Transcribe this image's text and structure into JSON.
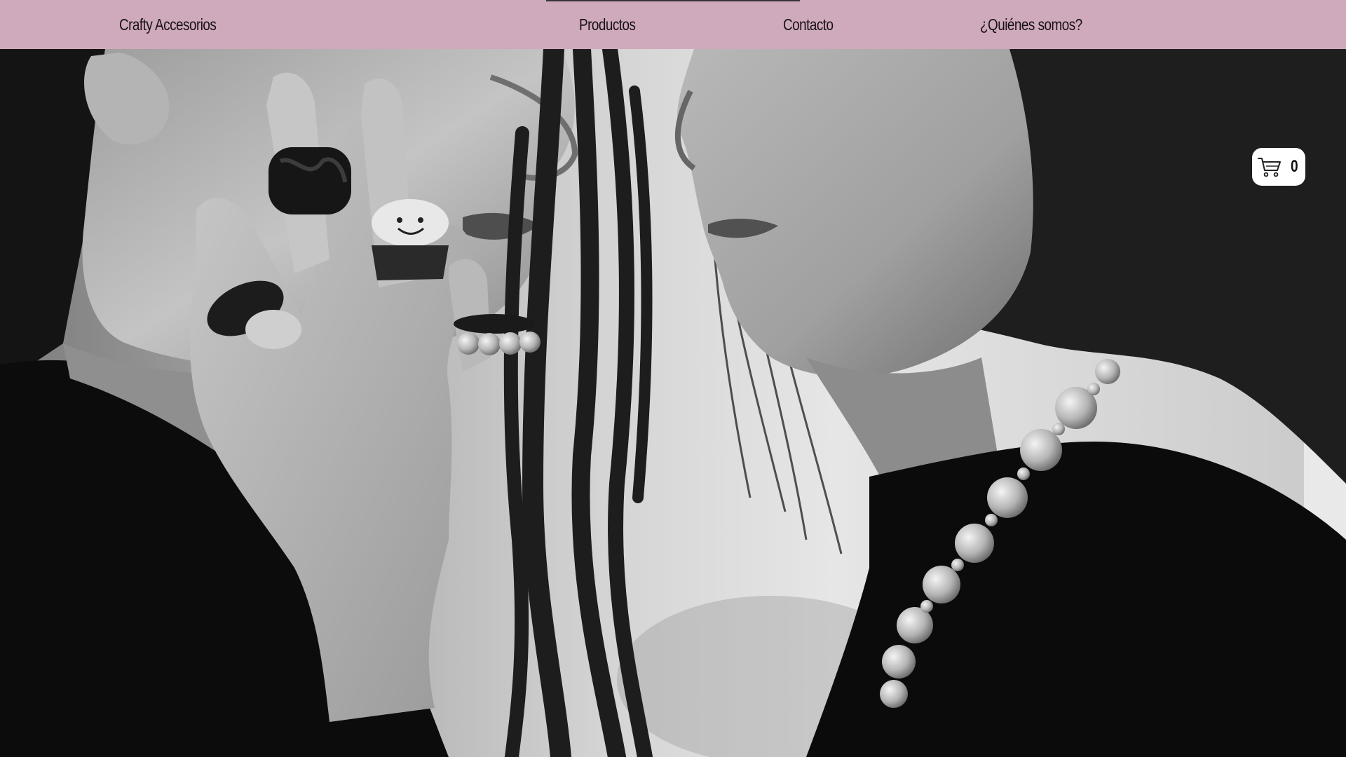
{
  "header": {
    "brand": "Crafty Accesorios",
    "nav": [
      {
        "label": "Productos",
        "active": true
      },
      {
        "label": "Contacto",
        "active": false
      },
      {
        "label": "¿Quiénes somos?",
        "active": false
      }
    ]
  },
  "cart": {
    "count": "0",
    "icon": "shopping-cart-icon"
  },
  "hero": {
    "image": "grayscale-photo-two-people-rings-pearl-necklace"
  },
  "colors": {
    "header_bg": "#cfa9bc",
    "nav_text": "#161214",
    "active_indicator": "#3a3438",
    "cart_bg": "#ffffff"
  }
}
